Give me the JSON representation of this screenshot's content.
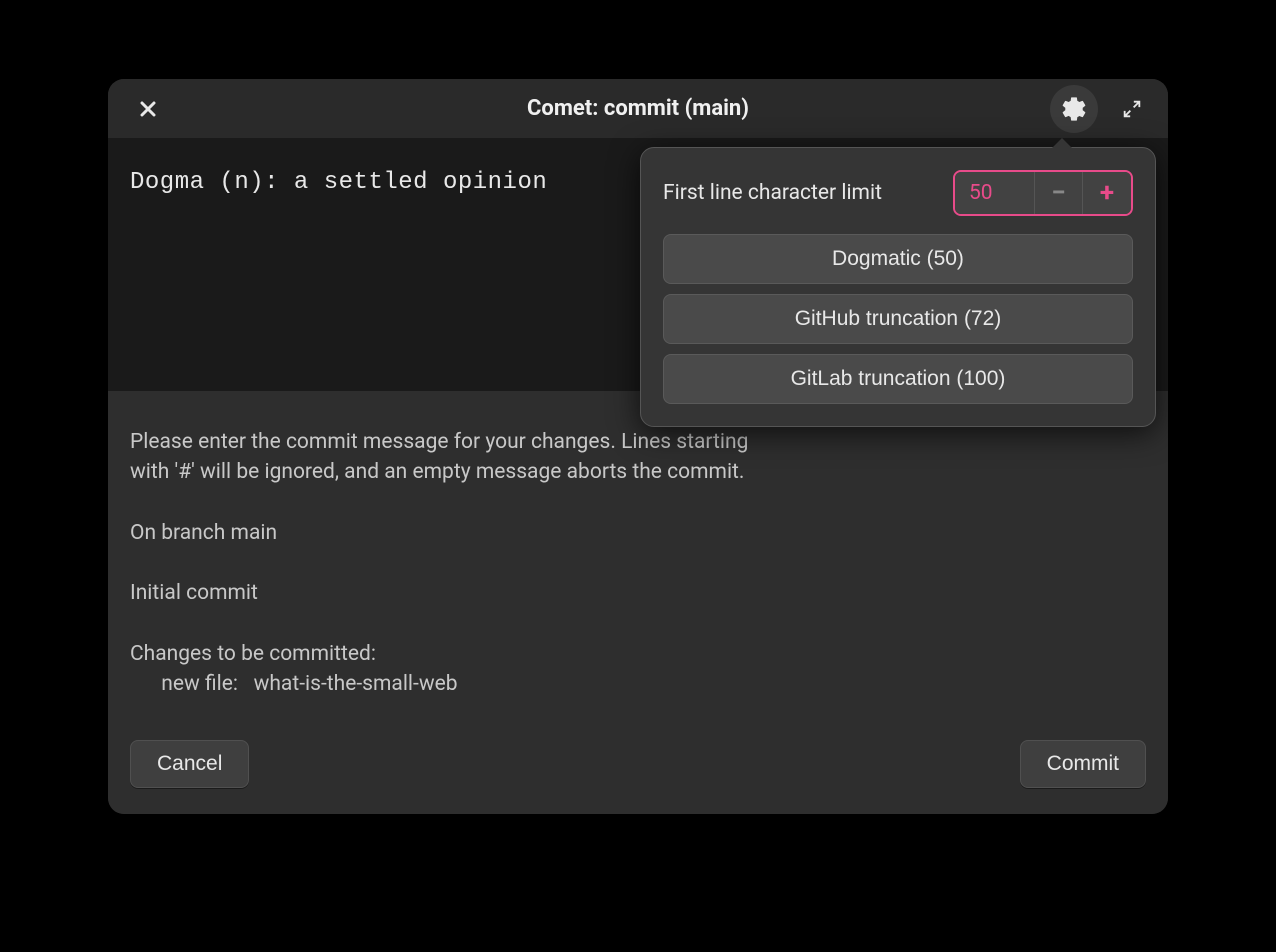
{
  "titlebar": {
    "title": "Comet: commit (main)"
  },
  "editor": {
    "text": "Dogma (n): a settled opinion"
  },
  "info": {
    "line1": "Please enter the commit message for your changes. Lines starting",
    "line2": "with '#' will be ignored, and an empty message aborts the commit.",
    "branch": "On branch main",
    "status": "Initial commit",
    "changes_header": "Changes to be committed:",
    "changes_item": "      new file:   what-is-the-small-web"
  },
  "buttons": {
    "cancel": "Cancel",
    "commit": "Commit"
  },
  "popover": {
    "limit_label": "First line character limit",
    "limit_value": "50",
    "preset1": "Dogmatic (50)",
    "preset2": "GitHub truncation (72)",
    "preset3": "GitLab truncation (100)"
  }
}
